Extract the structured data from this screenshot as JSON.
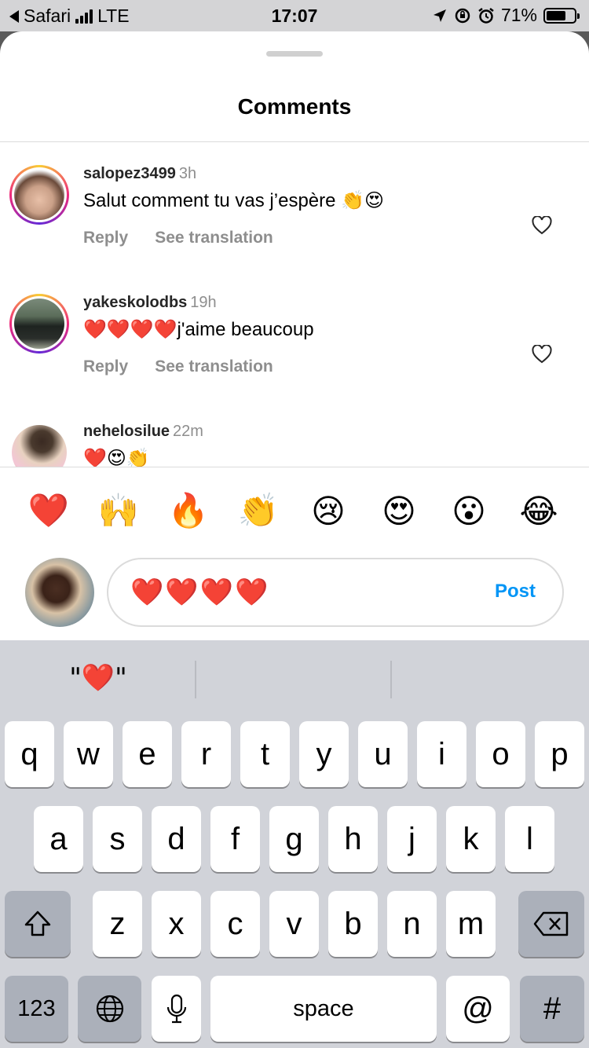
{
  "status_bar": {
    "back_app": "Safari",
    "network": "LTE",
    "time": "17:07",
    "battery": "71%",
    "battery_level": 0.71
  },
  "sheet": {
    "title": "Comments"
  },
  "comments": [
    {
      "username": "salopez3499",
      "time": "3h",
      "text": "Salut comment tu vas j’espère 👏😍",
      "reply_label": "Reply",
      "translate_label": "See translation"
    },
    {
      "username": "yakeskolodbs",
      "time": "19h",
      "text": "❤️❤️❤️❤️j'aime beaucoup",
      "reply_label": "Reply",
      "translate_label": "See translation"
    },
    {
      "username": "nehelosilue",
      "time": "22m",
      "text": "❤️😍👏"
    }
  ],
  "reactions": [
    "❤️",
    "🙌",
    "🔥",
    "👏",
    "😢",
    "😍",
    "😮",
    "😂"
  ],
  "composer": {
    "value": "❤️❤️❤️❤️",
    "post_label": "Post"
  },
  "keyboard": {
    "suggestions": [
      "\"❤️\"",
      "",
      ""
    ],
    "row1": [
      "q",
      "w",
      "e",
      "r",
      "t",
      "y",
      "u",
      "i",
      "o",
      "p"
    ],
    "row2": [
      "a",
      "s",
      "d",
      "f",
      "g",
      "h",
      "j",
      "k",
      "l"
    ],
    "row3": [
      "z",
      "x",
      "c",
      "v",
      "b",
      "n",
      "m"
    ],
    "numbers_label": "123",
    "space_label": "space",
    "at_label": "@",
    "hash_label": "#"
  },
  "colors": {
    "accent": "#0095f6",
    "ring_gradient": [
      "#f9ce34",
      "#ee2a7b",
      "#6228d7"
    ]
  }
}
